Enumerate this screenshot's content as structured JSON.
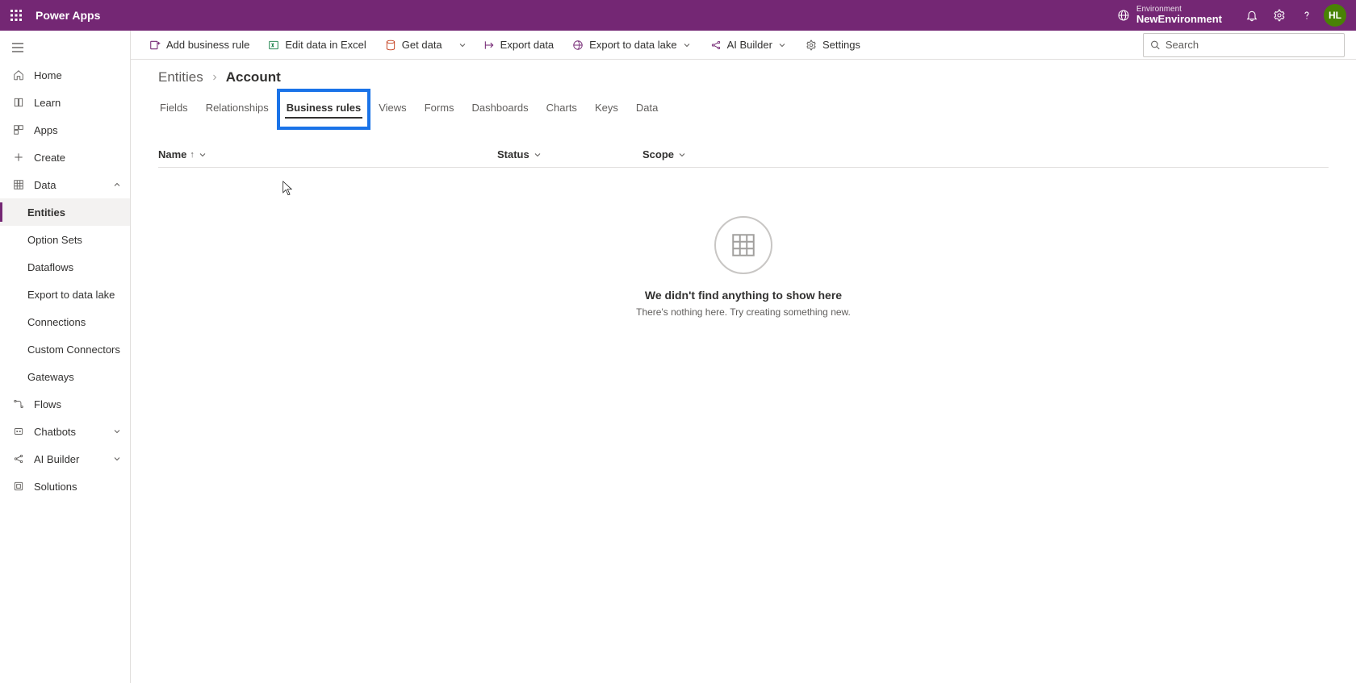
{
  "header": {
    "app_title": "Power Apps",
    "env_label": "Environment",
    "env_name": "NewEnvironment",
    "avatar_initials": "HL"
  },
  "sidebar": {
    "items": [
      {
        "label": "Home"
      },
      {
        "label": "Learn"
      },
      {
        "label": "Apps"
      },
      {
        "label": "Create"
      },
      {
        "label": "Data"
      },
      {
        "label": "Flows"
      },
      {
        "label": "Chatbots"
      },
      {
        "label": "AI Builder"
      },
      {
        "label": "Solutions"
      }
    ],
    "data_children": [
      {
        "label": "Entities"
      },
      {
        "label": "Option Sets"
      },
      {
        "label": "Dataflows"
      },
      {
        "label": "Export to data lake"
      },
      {
        "label": "Connections"
      },
      {
        "label": "Custom Connectors"
      },
      {
        "label": "Gateways"
      }
    ]
  },
  "commands": {
    "add": "Add business rule",
    "excel": "Edit data in Excel",
    "getdata": "Get data",
    "export": "Export data",
    "lake": "Export to data lake",
    "ai": "AI Builder",
    "settings": "Settings",
    "search_placeholder": "Search"
  },
  "breadcrumb": {
    "root": "Entities",
    "current": "Account"
  },
  "tabs": [
    {
      "label": "Fields"
    },
    {
      "label": "Relationships"
    },
    {
      "label": "Business rules"
    },
    {
      "label": "Views"
    },
    {
      "label": "Forms"
    },
    {
      "label": "Dashboards"
    },
    {
      "label": "Charts"
    },
    {
      "label": "Keys"
    },
    {
      "label": "Data"
    }
  ],
  "columns": {
    "name": "Name",
    "status": "Status",
    "scope": "Scope"
  },
  "empty": {
    "title": "We didn't find anything to show here",
    "sub": "There's nothing here. Try creating something new."
  }
}
